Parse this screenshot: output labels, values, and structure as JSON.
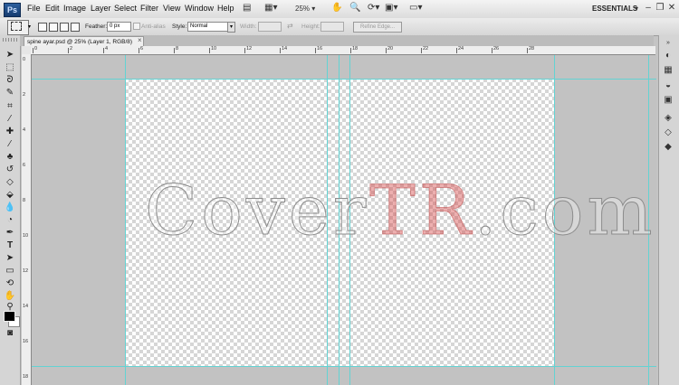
{
  "app": {
    "logo": "Ps",
    "workspace": "ESSENTIALS",
    "zoom_select": "25%"
  },
  "menu": [
    "File",
    "Edit",
    "Image",
    "Layer",
    "Select",
    "Filter",
    "View",
    "Window",
    "Help"
  ],
  "options": {
    "feather_label": "Feather:",
    "feather_value": "0 px",
    "antialias_label": "Anti-alias",
    "style_label": "Style:",
    "style_value": "Normal",
    "width_label": "Width:",
    "height_label": "Height:",
    "refine_edge_label": "Refine Edge..."
  },
  "document": {
    "tab_title": "spine ayar.psd @ 25% (Layer 1, RGB/8)",
    "close": "×"
  },
  "ruler_top": [
    "0",
    "2",
    "4",
    "6",
    "8",
    "10",
    "12",
    "14",
    "16",
    "18",
    "20",
    "22",
    "24",
    "26",
    "28"
  ],
  "ruler_left": [
    "0",
    "2",
    "4",
    "6",
    "8",
    "10",
    "12",
    "14",
    "16",
    "18"
  ],
  "watermark": {
    "part1": "Cover",
    "part2": "TR",
    "part3": ".com"
  },
  "colors": {
    "guide": "#63d3d3",
    "watermark_accent": "#d65050"
  },
  "icons": {
    "tools": [
      "move",
      "marquee",
      "lasso",
      "quick-select",
      "crop",
      "eyedropper",
      "healing",
      "brush",
      "clone-stamp",
      "history-brush",
      "eraser",
      "paint-bucket",
      "blur",
      "dodge",
      "pen",
      "type",
      "path-select",
      "shape",
      "3d-rotate",
      "hand",
      "zoom"
    ],
    "right_panel": [
      "collapse-arrows",
      "color",
      "swatches",
      "adjustments",
      "styles",
      "layers",
      "channels",
      "paths"
    ]
  }
}
